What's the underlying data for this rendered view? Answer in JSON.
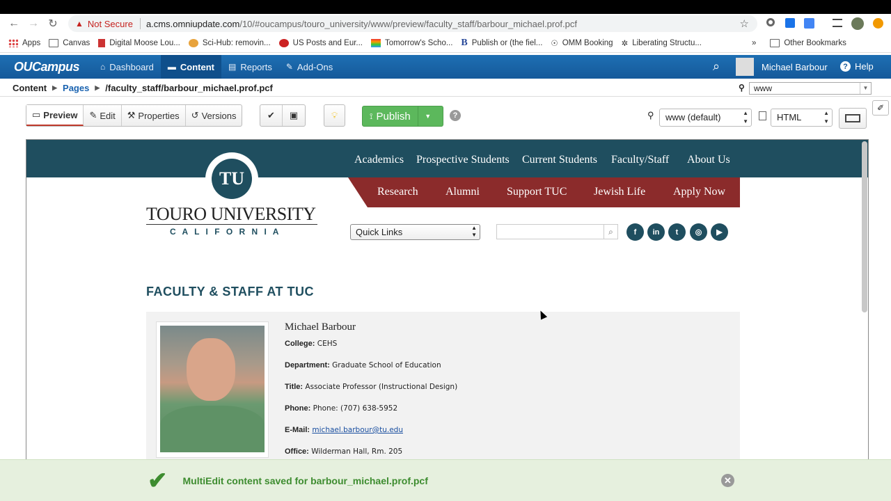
{
  "browser": {
    "security": "Not Secure",
    "url_host": "a.cms.omniupdate.com",
    "url_path": "/10/#oucampus/touro_university/www/preview/faculty_staff/barbour_michael.prof.pcf"
  },
  "bookmarks": [
    "Apps",
    "Canvas",
    "Digital Moose Lou...",
    "Sci-Hub: removin...",
    "US Posts and Eur...",
    "Tomorrow's Scho...",
    "Publish or (the fiel...",
    "OMM Booking",
    "Liberating Structu..."
  ],
  "bookmarks_more": "»",
  "other_bookmarks": "Other Bookmarks",
  "ou": {
    "logo": "OUCampus",
    "nav": [
      {
        "label": "Dashboard",
        "icon": "home-icon"
      },
      {
        "label": "Content",
        "icon": "folder-icon"
      },
      {
        "label": "Reports",
        "icon": "report-icon"
      },
      {
        "label": "Add-Ons",
        "icon": "pin-icon"
      }
    ],
    "user": "Michael Barbour",
    "help": "Help"
  },
  "breadcrumb": {
    "root": "Content",
    "pages": "Pages",
    "path": "/faculty_staff/barbour_michael.prof.pcf",
    "site": "www"
  },
  "toolbar": {
    "tabs": [
      "Preview",
      "Edit",
      "Properties",
      "Versions"
    ],
    "publish": "Publish",
    "target": "www (default)",
    "format": "HTML"
  },
  "site": {
    "nav_top": [
      "Academics",
      "Prospective Students",
      "Current Students",
      "Faculty/Staff",
      "About Us"
    ],
    "nav_sub": [
      "Research",
      "Alumni",
      "Support TUC",
      "Jewish Life",
      "Apply Now"
    ],
    "logo_main": "TOURO UNIVERSITY",
    "logo_sub": "C A L I F O R N I A",
    "logo_mark": "TU",
    "quick_links": "Quick Links",
    "social": [
      "f",
      "in",
      "t",
      "◎",
      "▶"
    ],
    "heading": "FACULTY & STAFF AT TUC",
    "profile": {
      "name": "Michael Barbour",
      "college_label": "College:",
      "college": "CEHS",
      "department_label": "Department:",
      "department": "Graduate School of Education",
      "title_label": "Title:",
      "title": "Associate Professor (Instructional Design)",
      "phone_label": "Phone:",
      "phone": "Phone: (707) 638-5952",
      "email_label": "E-Mail:",
      "email": "michael.barbour@tu.edu",
      "office_label": "Office:",
      "office": "Wilderman Hall, Rm. 205"
    }
  },
  "toast": {
    "message": "MultiEdit content saved for barbour_michael.prof.pcf"
  },
  "colors": {
    "ou_blue": "#1e6fb3",
    "site_teal": "#1f4e5f",
    "site_red": "#8b2b2b",
    "publish_green": "#5cb85c",
    "toast_green": "#3d8c2f"
  }
}
